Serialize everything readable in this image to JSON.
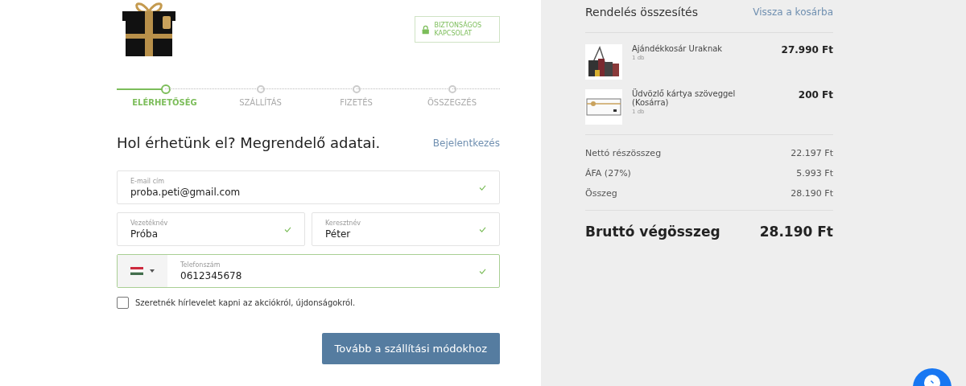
{
  "secure_badge": "BIZTONSÁGOS KAPCSOLAT",
  "steps": [
    {
      "label": "ELÉRHETŐSÉG",
      "selected": true
    },
    {
      "label": "SZÁLLÍTÁS",
      "selected": false
    },
    {
      "label": "FIZETÉS",
      "selected": false
    },
    {
      "label": "ÖSSZEGZÉS",
      "selected": false
    }
  ],
  "heading": "Hol érhetünk el? Megrendelő adatai.",
  "login_link": "Bejelentkezés",
  "fields": [
    {
      "kind": "text",
      "label": "E-mail cím",
      "value": "proba.peti@gmail.com",
      "valid": true,
      "active": false
    },
    {
      "kind": "text",
      "label": "Vezetéknév",
      "value": "Próba",
      "valid": true,
      "active": false
    },
    {
      "kind": "text",
      "label": "Keresztnév",
      "value": "Péter",
      "valid": true,
      "active": false
    },
    {
      "kind": "phone",
      "label": "Telefonszám",
      "value": "0612345678",
      "valid": true,
      "active": true
    }
  ],
  "newsletter": {
    "label": "Szeretnék hírlevelet kapni az akciókról, újdonságokról.",
    "checked": false
  },
  "submit": "Tovább a szállítási módokhoz",
  "summary": {
    "title": "Rendelés összesítés",
    "back_link": "Vissza a kosárba",
    "items": [
      {
        "name": "Ajándékkosár Uraknak",
        "qty": "1 db",
        "price": "27.990 Ft",
        "kind": "basket"
      },
      {
        "name": "Üdvözlő kártya szöveggel (Kosárra)",
        "qty": "1 db",
        "price": "200 Ft",
        "kind": "card"
      }
    ],
    "lines": [
      {
        "label": "Nettó részösszeg",
        "value": "22.197 Ft"
      },
      {
        "label": "ÁFA (27%)",
        "value": "5.993 Ft"
      },
      {
        "label": "Összeg",
        "value": "28.190 Ft"
      }
    ],
    "total": {
      "label": "Bruttó végösszeg",
      "value": "28.190 Ft"
    }
  }
}
